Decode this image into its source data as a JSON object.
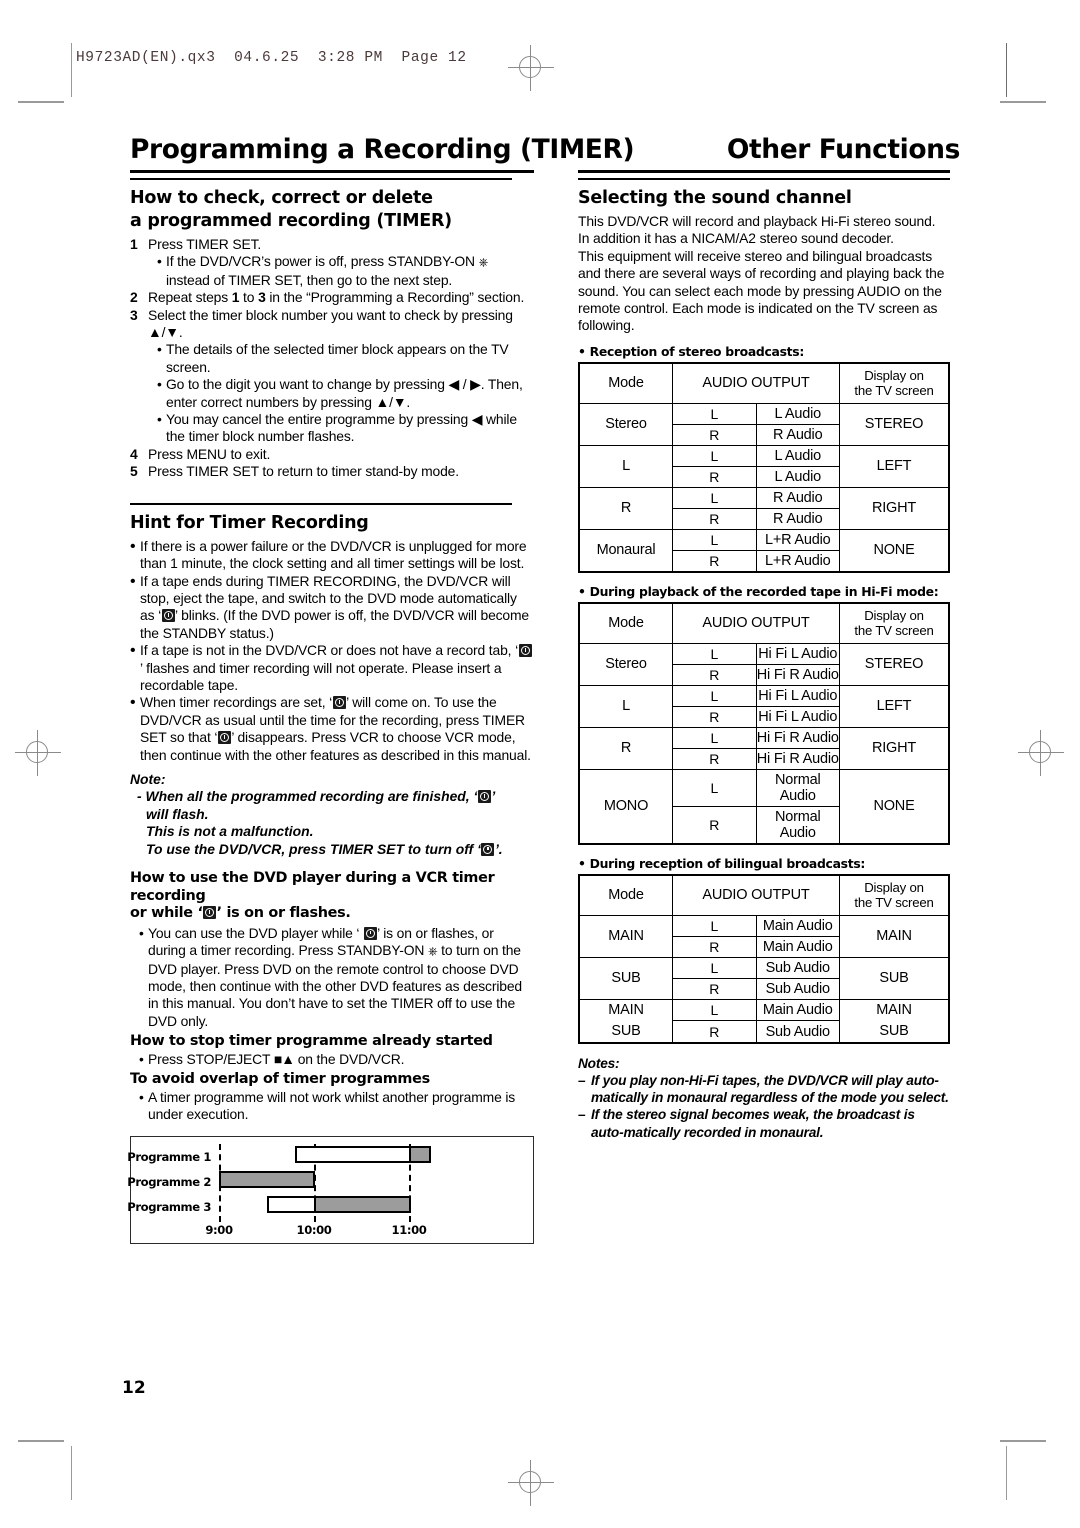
{
  "page_slug": "H9723AD(EN).qx3  04.6.25  3:28 PM  Page 12",
  "folio": "12",
  "heads": {
    "left": "Programming a Recording (TIMER)",
    "right": "Other Functions"
  },
  "left_column": {
    "section1_title_line1": "How to check, correct or delete",
    "section1_title_line2": "a programmed recording (TIMER)",
    "steps": [
      {
        "num": "1",
        "text": "Press TIMER SET.",
        "bullets": [
          "If the DVD/VCR’s power is off, press STANDBY-ON ⏻ instead of TIMER SET, then go to the next step."
        ]
      },
      {
        "num": "2",
        "text": "Repeat steps 1 to 3 in the “Programming a Recording” section.",
        "bullets": []
      },
      {
        "num": "3",
        "text": "Select the timer block number you want to check by pressing ▲/▼.",
        "bullets": [
          "The details of the selected timer block appears on the TV screen.",
          "Go to the digit you want to change by pressing ◀ / ▶. Then, enter correct numbers by pressing ▲/▼.",
          "You may cancel the entire programme by pressing ◀ while the timer block number flashes."
        ]
      },
      {
        "num": "4",
        "text": "Press MENU to exit.",
        "bullets": []
      },
      {
        "num": "5",
        "text": "Press TIMER SET to return to timer stand-by mode.",
        "bullets": []
      }
    ],
    "hint_title": "Hint for Timer Recording",
    "hint_bullets": [
      "If there is a power failure or the DVD/VCR is unplugged for more than 1 minute, the clock setting and all timer settings will be lost.",
      "If a tape ends during TIMER RECORDING, the DVD/VCR will stop, eject the tape, and switch to the DVD mode automatically as ‘[TIMER]’ blinks. (If the DVD power is off, the DVD/VCR will become the STANDBY status.)",
      "If a tape is not in the DVD/VCR or does not have a record tab, ‘[TIMER]’ flashes and timer recording will not operate. Please insert a recordable tape.",
      "When timer recordings are set, ‘[TIMER]’ will come on. To use the DVD/VCR as usual until the time for the recording, press TIMER SET so that ‘[TIMER]’ disappears. Press VCR to choose VCR mode, then continue with the other features as described in this manual."
    ],
    "note_label": "Note:",
    "note_lines": [
      "- When all the programmed recording are finished, ‘[TIMER]’",
      "will flash.",
      "This is not a malfunction.",
      "To use the DVD/VCR, press TIMER SET to turn off ‘[TIMER]’."
    ],
    "subhead_dvd_during_vcr_line1": "How to use the DVD player during a VCR timer recording",
    "subhead_dvd_during_vcr_line2": "or while ‘[TIMER]’ is on or flashes.",
    "dvd_during_vcr_bullet": "You can use the DVD player while ‘[TIMER]’ is on or flashes, or during a timer recording. Press STANDBY-ON ⏻ to turn on the DVD player. Press DVD on the remote control to choose DVD mode, then continue with the other DVD features as described in this manual. You don’t have to set the TIMER off to use the DVD only.",
    "subhead_stop_timer": "How to stop timer programme already started",
    "stop_timer_bullet": "Press STOP/EJECT ■▲ on the DVD/VCR.",
    "subhead_avoid_overlap": "To avoid overlap of timer programmes",
    "avoid_overlap_bullet": "A timer programme will not work whilst another programme is under execution."
  },
  "chart_data": {
    "type": "bar",
    "title": "",
    "orientation": "horizontal-gantt",
    "categories": [
      "Programme 1",
      "Programme 2",
      "Programme 3"
    ],
    "xlabel": "",
    "ylabel": "",
    "x_tick_labels": [
      "9:00",
      "10:00",
      "11:00"
    ],
    "x_tick_values": [
      9.0,
      10.0,
      11.0
    ],
    "xlim": [
      8.6,
      11.6
    ],
    "grid": "dashed vertical gridlines at 9:00, 10:00, 11:00",
    "legend": "white = not recorded / grey = recorded portion",
    "bars": [
      {
        "category": "Programme 1",
        "segments": [
          {
            "start": 9.8,
            "end": 11.0,
            "fill": "white",
            "color": "#ffffff"
          },
          {
            "start": 11.0,
            "end": 11.2,
            "fill": "grey",
            "color": "#9c9c9c"
          }
        ]
      },
      {
        "category": "Programme 2",
        "segments": [
          {
            "start": 9.0,
            "end": 10.0,
            "fill": "grey",
            "color": "#9c9c9c"
          }
        ]
      },
      {
        "category": "Programme 3",
        "segments": [
          {
            "start": 9.5,
            "end": 10.0,
            "fill": "white",
            "color": "#ffffff"
          },
          {
            "start": 10.0,
            "end": 11.0,
            "fill": "grey",
            "color": "#9c9c9c"
          }
        ]
      }
    ]
  },
  "right_column": {
    "section_title": "Selecting the sound channel",
    "intro_paragraphs": [
      "This DVD/VCR will record and playback Hi-Fi stereo sound. In addition it has a NICAM/A2 stereo sound decoder.",
      "This equipment will receive stereo and bilingual broadcasts and there are several ways of recording and playing back the sound. You can select each mode by pressing AUDIO on the remote control. Each mode is indicated on the TV screen as following."
    ],
    "tables": [
      {
        "caption": "• Reception of stereo broadcasts:",
        "header": {
          "mode": "Mode",
          "output": "AUDIO OUTPUT",
          "display_l1": "Display on",
          "display_l2": "the TV screen"
        },
        "rows": [
          {
            "mode": "Stereo",
            "l": "L Audio",
            "r": "R Audio",
            "display": "STEREO"
          },
          {
            "mode": "L",
            "l": "L Audio",
            "r": "L Audio",
            "display": "LEFT"
          },
          {
            "mode": "R",
            "l": "R Audio",
            "r": "R Audio",
            "display": "RIGHT"
          },
          {
            "mode": "Monaural",
            "l": "L+R Audio",
            "r": "L+R Audio",
            "display": "NONE"
          }
        ]
      },
      {
        "caption": "• During playback of the recorded tape in Hi-Fi mode:",
        "header": {
          "mode": "Mode",
          "output": "AUDIO OUTPUT",
          "display_l1": "Display on",
          "display_l2": "the TV screen"
        },
        "rows": [
          {
            "mode": "Stereo",
            "l": "Hi Fi L Audio",
            "r": "Hi Fi R Audio",
            "display": "STEREO"
          },
          {
            "mode": "L",
            "l": "Hi Fi L Audio",
            "r": "Hi Fi L Audio",
            "display": "LEFT"
          },
          {
            "mode": "R",
            "l": "Hi Fi R Audio",
            "r": "Hi Fi R Audio",
            "display": "RIGHT"
          },
          {
            "mode": "MONO",
            "l": "Normal Audio",
            "r": "Normal Audio",
            "display": "NONE"
          }
        ]
      },
      {
        "caption": "• During reception of bilingual broadcasts:",
        "header": {
          "mode": "Mode",
          "output": "AUDIO OUTPUT",
          "display_l1": "Display on",
          "display_l2": "the TV screen"
        },
        "rows": [
          {
            "mode": "MAIN",
            "l": "Main Audio",
            "r": "Main Audio",
            "display": "MAIN"
          },
          {
            "mode": "SUB",
            "l": "Sub Audio",
            "r": "Sub Audio",
            "display": "SUB"
          },
          {
            "mode": "MAIN\nSUB",
            "l": "Main Audio",
            "r": "Sub Audio",
            "display": "MAIN\nSUB"
          }
        ]
      }
    ],
    "row_labels": {
      "left": "L",
      "right": "R"
    },
    "notes_label": "Notes:",
    "notes": [
      "– If you play non-Hi-Fi tapes, the DVD/VCR will play automatically in monaural regardless of the mode you select.",
      "– If the stereo signal becomes weak, the broadcast is automatically recorded in monaural."
    ]
  }
}
